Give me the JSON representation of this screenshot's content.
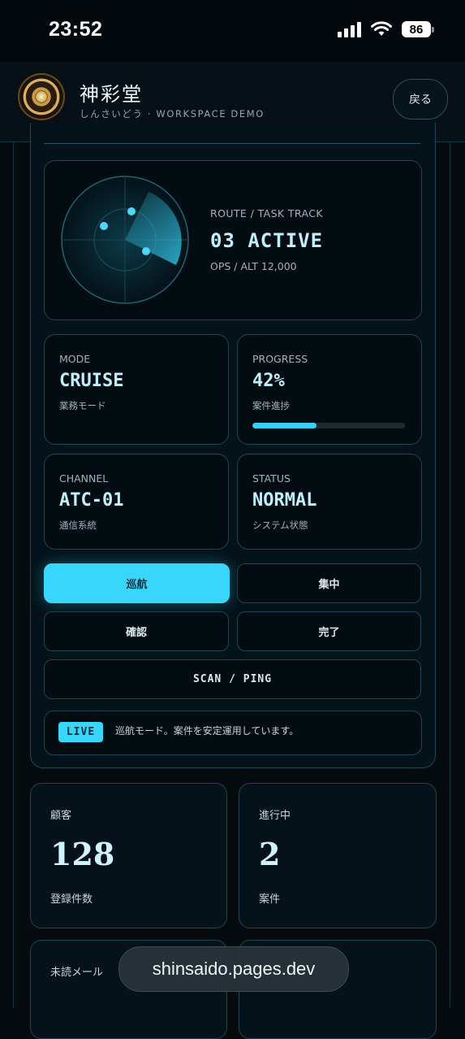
{
  "status_bar": {
    "time": "23:52",
    "battery": "86"
  },
  "header": {
    "title": "神彩堂",
    "subtitle": "しんさいどう · WORKSPACE DEMO",
    "back_label": "戻る"
  },
  "route": {
    "label": "ROUTE / TASK TRACK",
    "value": "03 ACTIVE",
    "sub": "OPS / ALT 12,000"
  },
  "stats": {
    "mode": {
      "label": "MODE",
      "value": "CRUISE",
      "sub": "業務モード"
    },
    "progress": {
      "label": "PROGRESS",
      "value": "42%",
      "sub": "案件進捗",
      "fraction": 0.42
    },
    "channel": {
      "label": "CHANNEL",
      "value": "ATC-01",
      "sub": "通信系統"
    },
    "status": {
      "label": "STATUS",
      "value": "NORMAL",
      "sub": "システム状態"
    }
  },
  "modes": {
    "cruise": "巡航",
    "focus": "集中",
    "confirm": "確認",
    "done": "完了",
    "scan": "SCAN / PING"
  },
  "live": {
    "badge": "LIVE",
    "message": "巡航モード。案件を安定運用しています。"
  },
  "metrics": [
    {
      "label": "顧客",
      "value": "128",
      "sub": "登録件数"
    },
    {
      "label": "進行中",
      "value": "2",
      "sub": "案件"
    },
    {
      "label": "未読メール"
    }
  ],
  "url": "shinsaido.pages.dev",
  "colors": {
    "accent": "#38d6fb",
    "background": "#050b0f",
    "border": "#1f4652"
  }
}
